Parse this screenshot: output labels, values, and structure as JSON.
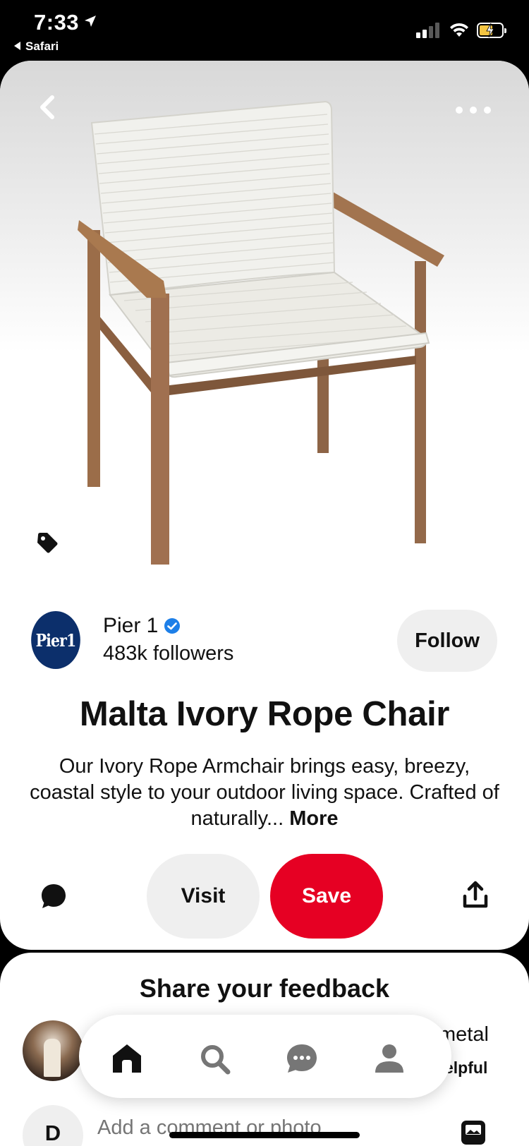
{
  "status_bar": {
    "time": "7:33",
    "back_app": "Safari",
    "battery_color": "#f4c542"
  },
  "pin": {
    "image_alt": "chair-photo",
    "icons": {
      "back": "chevron-left-icon",
      "more": "more-dots-icon",
      "tag": "tag-icon"
    },
    "creator": {
      "logo_text": "Pier1",
      "name": "Pier 1",
      "verified": true,
      "followers": "483k followers",
      "follow_label": "Follow"
    },
    "title": "Malta Ivory Rope Chair",
    "description": "Our Ivory Rope Armchair brings easy, breezy, coastal style to your outdoor living space. Crafted of naturally...",
    "more_label": "More",
    "actions": {
      "visit_label": "Visit",
      "save_label": "Save",
      "save_color": "#e60023"
    }
  },
  "feedback": {
    "title": "Share your feedback",
    "snippet_line_1": "metal",
    "snippet_line_2": "elpful",
    "user_initial": "D",
    "input_placeholder": "Add a comment or photo"
  },
  "nav": {
    "items": [
      "home-icon",
      "search-icon",
      "messages-icon",
      "profile-icon"
    ]
  }
}
